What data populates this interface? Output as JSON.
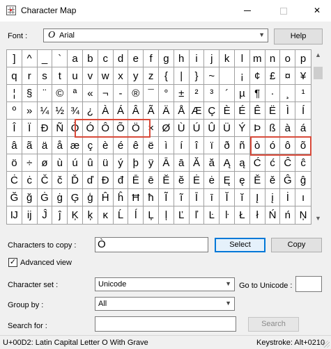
{
  "window": {
    "title": "Character Map",
    "minimize": "—",
    "close": "✕"
  },
  "font": {
    "label": "Font :",
    "selected": "Arial",
    "font_icon": "font-type-icon"
  },
  "help_button": "Help",
  "grid_rows": [
    [
      "]",
      "^",
      "_",
      "`",
      "a",
      "b",
      "c",
      "d",
      "e",
      "f",
      "g",
      "h",
      "i",
      "j",
      "k",
      "l",
      "m",
      "n",
      "o",
      "p"
    ],
    [
      "q",
      "r",
      "s",
      "t",
      "u",
      "v",
      "w",
      "x",
      "y",
      "z",
      "{",
      "|",
      "}",
      "~",
      " ",
      "¡",
      "¢",
      "£",
      "¤",
      "¥"
    ],
    [
      "¦",
      "§",
      "¨",
      "©",
      "ª",
      "«",
      "¬",
      "-",
      "®",
      "¯",
      "°",
      "±",
      "²",
      "³",
      "´",
      "µ",
      "¶",
      "·",
      "¸",
      "¹"
    ],
    [
      "º",
      "»",
      "¼",
      "½",
      "¾",
      "¿",
      "À",
      "Á",
      "Â",
      "Ã",
      "Ä",
      "Å",
      "Æ",
      "Ç",
      "È",
      "É",
      "Ê",
      "Ë",
      "Ì",
      "Í"
    ],
    [
      "Î",
      "Ï",
      "Ð",
      "Ñ",
      "Ò",
      "Ó",
      "Ô",
      "Õ",
      "Ö",
      "×",
      "Ø",
      "Ù",
      "Ú",
      "Û",
      "Ü",
      "Ý",
      "Þ",
      "ß",
      "à",
      "á"
    ],
    [
      "â",
      "ã",
      "ä",
      "å",
      "æ",
      "ç",
      "è",
      "é",
      "ê",
      "ë",
      "ì",
      "í",
      "î",
      "ï",
      "ð",
      "ñ",
      "ò",
      "ó",
      "ô",
      "õ"
    ],
    [
      "ö",
      "÷",
      "ø",
      "ù",
      "ú",
      "û",
      "ü",
      "ý",
      "þ",
      "ÿ",
      "Ā",
      "ā",
      "Ă",
      "ă",
      "Ą",
      "ą",
      "Ć",
      "ć",
      "Ĉ",
      "ĉ"
    ],
    [
      "Ċ",
      "ċ",
      "Č",
      "č",
      "Ď",
      "ď",
      "Đ",
      "đ",
      "Ē",
      "ē",
      "Ĕ",
      "ĕ",
      "Ė",
      "ė",
      "Ę",
      "ę",
      "Ě",
      "ě",
      "Ĝ",
      "ĝ"
    ],
    [
      "Ğ",
      "ğ",
      "Ġ",
      "ġ",
      "Ģ",
      "ģ",
      "Ĥ",
      "ĥ",
      "Ħ",
      "ħ",
      "Ĩ",
      "ĩ",
      "Ī",
      "ī",
      "Ĭ",
      "ĭ",
      "Į",
      "į",
      "İ",
      "ı"
    ],
    [
      "Ĳ",
      "ĳ",
      "Ĵ",
      "ĵ",
      "Ķ",
      "ķ",
      "ĸ",
      "Ĺ",
      "ĺ",
      "Ļ",
      "ļ",
      "Ľ",
      "ľ",
      "Ŀ",
      "ŀ",
      "Ł",
      "ł",
      "Ń",
      "ń",
      "Ņ"
    ]
  ],
  "copy": {
    "label": "Characters to copy :",
    "value": "Ò",
    "select_button": "Select",
    "copy_button": "Copy"
  },
  "advanced": {
    "label": "Advanced view",
    "checked": true,
    "check_mark": "✓"
  },
  "charset": {
    "label": "Character set :",
    "value": "Unicode"
  },
  "goto": {
    "label": "Go to Unicode :",
    "value": ""
  },
  "group": {
    "label": "Group by :",
    "value": "All"
  },
  "search": {
    "label": "Search for :",
    "value": "",
    "button": "Search"
  },
  "status": {
    "description": "U+00D2: Latin Capital Letter O With Grave",
    "keystroke": "Keystroke: Alt+0210"
  },
  "colors": {
    "highlight": "#d84a3a",
    "select_border": "#0078d7"
  }
}
